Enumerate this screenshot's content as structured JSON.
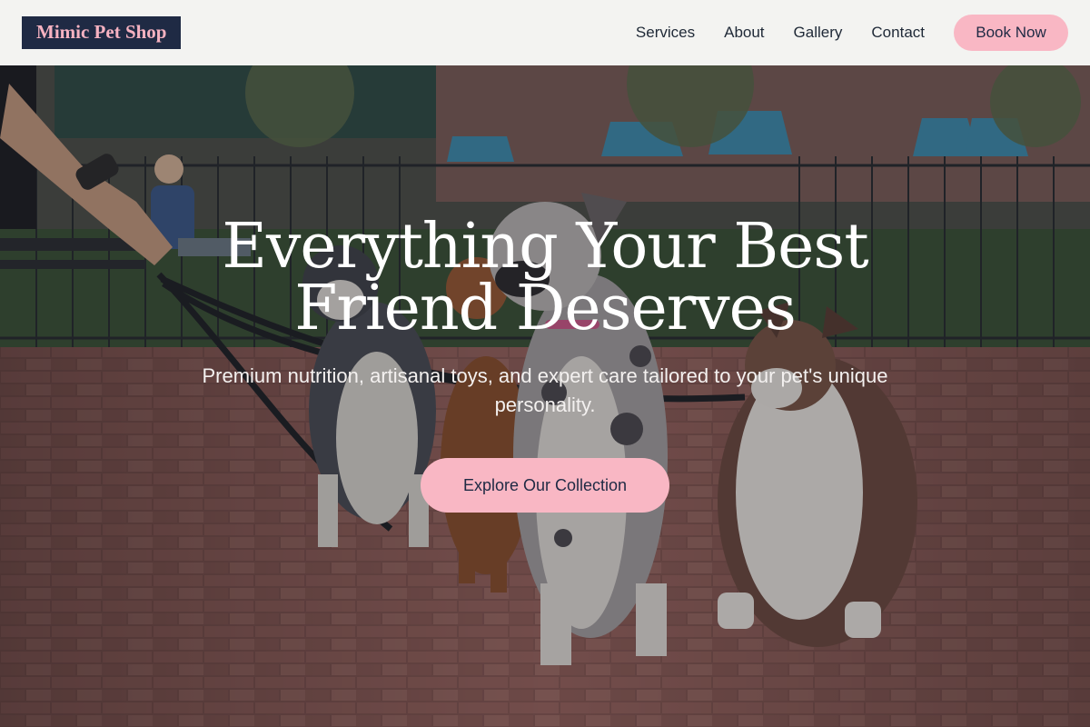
{
  "header": {
    "logo": "Mimic Pet Shop",
    "nav": [
      "Services",
      "About",
      "Gallery",
      "Contact"
    ],
    "book_label": "Book Now"
  },
  "hero": {
    "headline": "Everything Your Best Friend Deserves",
    "subtitle": "Premium nutrition, artisanal toys, and expert care tailored to your pet's unique personality.",
    "cta_label": "Explore Our Collection",
    "background": "photo of four dogs on leashes sitting on a brick plaza"
  },
  "colors": {
    "brand_navy": "#1f2a44",
    "accent_pink": "#f9b7c4",
    "header_bg": "#f3f3f1"
  }
}
